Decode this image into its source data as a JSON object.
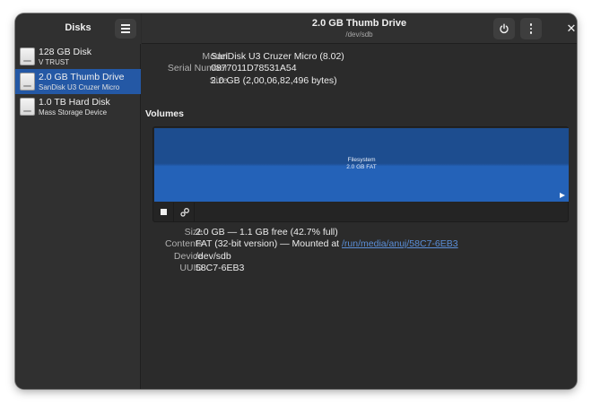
{
  "sidebar": {
    "title": "Disks",
    "menu_icon": "hamburger-menu-icon",
    "disks": [
      {
        "name": "128 GB Disk",
        "subtitle": "V TRUST",
        "selected": false
      },
      {
        "name": "2.0 GB Thumb Drive",
        "subtitle": "SanDisk U3 Cruzer Micro",
        "selected": true
      },
      {
        "name": "1.0 TB Hard Disk",
        "subtitle": "Mass Storage Device",
        "selected": false
      }
    ]
  },
  "header": {
    "title": "2.0 GB Thumb Drive",
    "subtitle": "/dev/sdb",
    "power_icon": "power-icon",
    "more_icon": "kebab-menu-icon",
    "close_glyph": "✕"
  },
  "drive": {
    "model_label": "Model",
    "model": "SanDisk U3 Cruzer Micro (8.02)",
    "serial_label": "Serial Number",
    "serial": "0877011D78531A54",
    "size_label": "Size",
    "size": "2.0 GB (2,00,06,82,496 bytes)"
  },
  "volumes": {
    "heading": "Volumes",
    "partition_type": "Filesystem",
    "partition_size": "2.0 GB FAT",
    "partition_color": "#2462b8",
    "stop_icon": "stop-icon",
    "settings_icon": "gears-icon"
  },
  "volume_info": {
    "size_label": "Size",
    "size": "2.0 GB — 1.1 GB free (42.7% full)",
    "contents_label": "Contents",
    "contents_prefix": "FAT (32-bit version) — Mounted at ",
    "mount_path": "/run/media/anuj/58C7-6EB3",
    "device_label": "Device",
    "device": "/dev/sdb",
    "uuid_label": "UUID",
    "uuid": "58C7-6EB3"
  }
}
